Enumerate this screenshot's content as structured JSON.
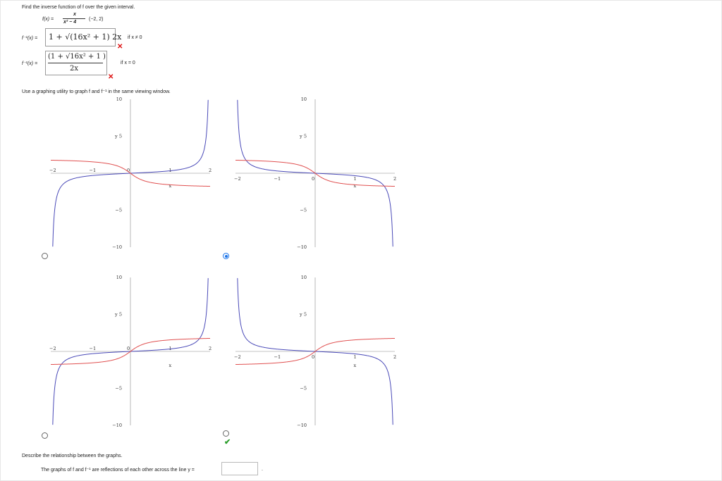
{
  "question": {
    "instruction": "Find the inverse function of f over the given interval.",
    "function_label": "f(x) =",
    "numerator": "x",
    "denominator": "x² − 4",
    "interval": "(−2, 2)"
  },
  "answers": {
    "row1": {
      "label": "f⁻¹(x) =",
      "expression": "1 + √(16x² + 1) 2x",
      "condition": "if x ≠ 0",
      "status": "incorrect"
    },
    "row2": {
      "label": "f⁻¹(x) =",
      "numerator": "(1 + √16x² + 1 )",
      "denominator": "2x",
      "condition": "if x = 0",
      "status": "incorrect"
    }
  },
  "graph_prompt": "Use a graphing utility to graph f and f⁻¹ in the same viewing window.",
  "graph_axes": {
    "x_ticks": [
      "−2",
      "−1",
      "0",
      "1",
      "2"
    ],
    "y_ticks": [
      "10",
      "5",
      "−5",
      "−10"
    ],
    "x_label": "x",
    "y_label": "y"
  },
  "graph_options": [
    {
      "id": "option-a",
      "selected": false
    },
    {
      "id": "option-b",
      "selected": true
    },
    {
      "id": "option-c",
      "selected": false
    },
    {
      "id": "option-d",
      "selected": false,
      "marked_correct": true
    }
  ],
  "colors": {
    "f_curve": "#e05050",
    "inverse_curve": "#4a4ab8",
    "correct": "#2a9d2a",
    "incorrect": "#d11111",
    "radio_selected": "#1a73e8"
  },
  "describe": {
    "prompt": "Describe the relationship between the graphs.",
    "sentence": "The graphs of f and f⁻¹ are reflections of each other across the line y =",
    "input_value": ""
  }
}
